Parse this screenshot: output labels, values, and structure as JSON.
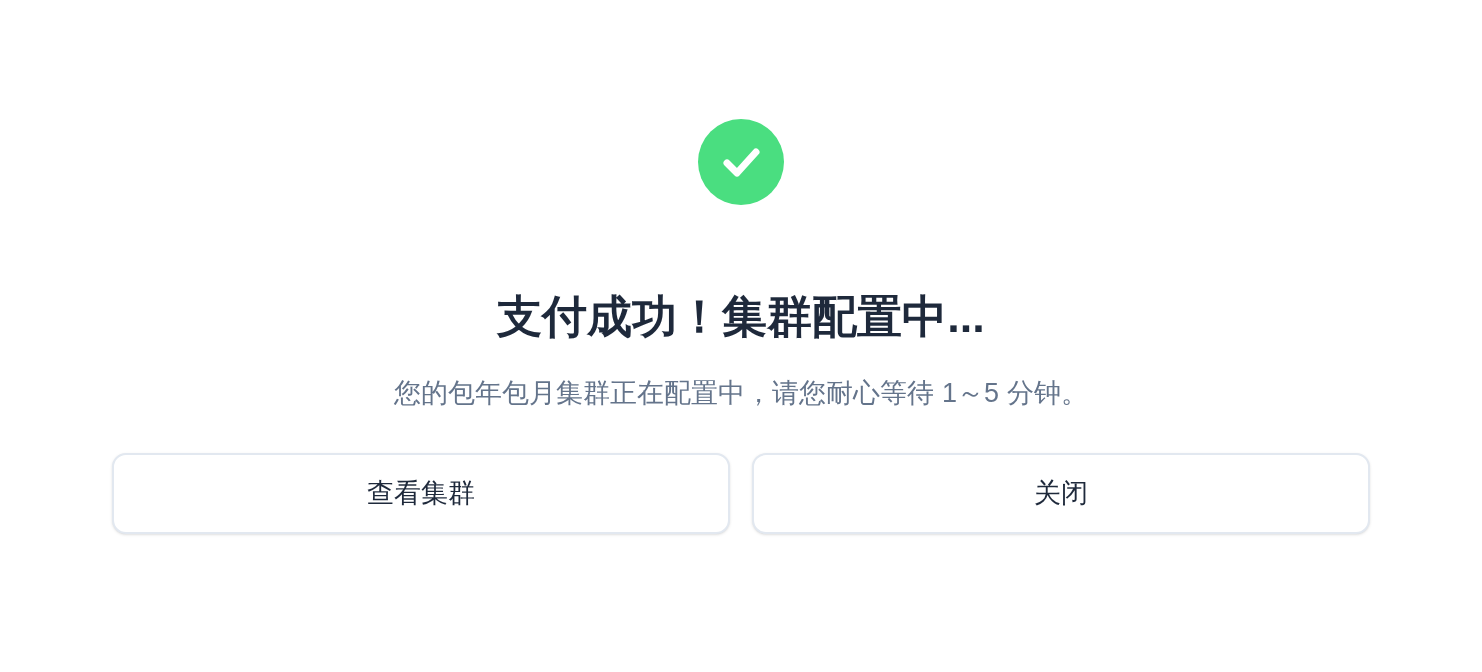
{
  "title": "支付成功！集群配置中...",
  "message": "您的包年包月集群正在配置中，请您耐心等待 1～5 分钟。",
  "buttons": [
    "查看集群",
    "关闭"
  ]
}
